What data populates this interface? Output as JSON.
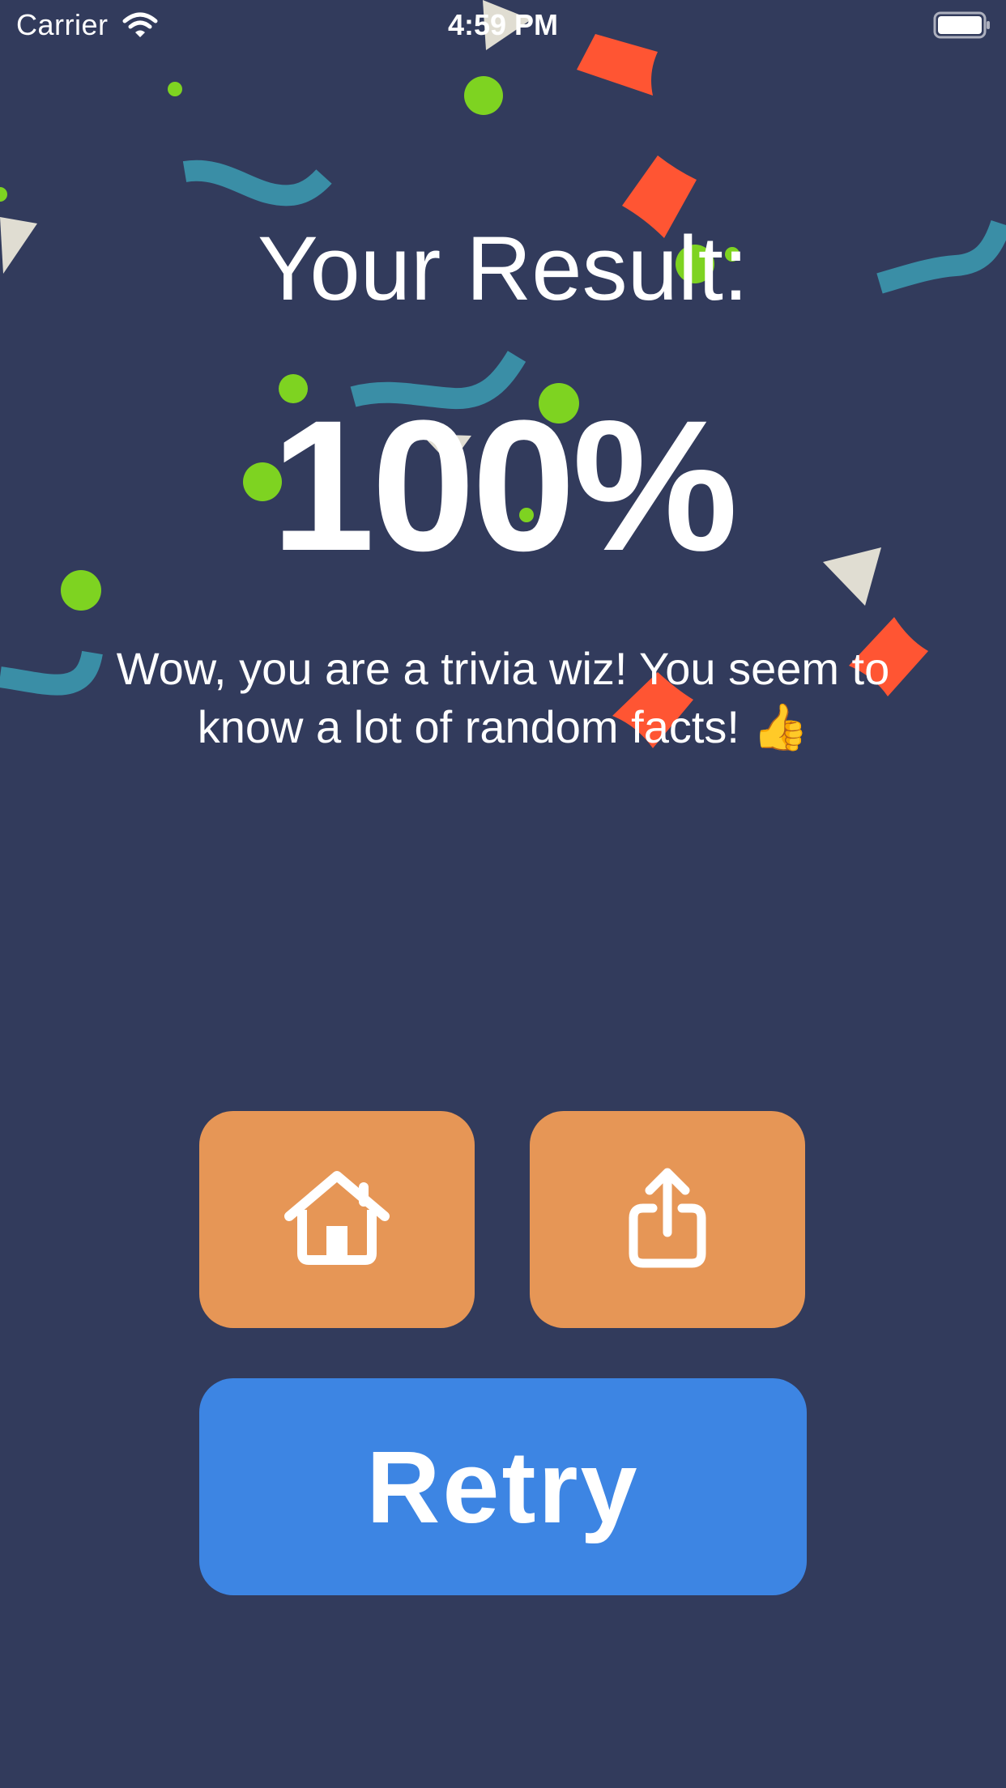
{
  "status_bar": {
    "carrier": "Carrier",
    "time": "4:59 PM",
    "wifi_icon": "wifi-icon",
    "battery_icon": "battery-icon"
  },
  "result": {
    "title": "Your Result:",
    "score": "100%",
    "message": "Wow, you are a trivia wiz! You seem to know a lot of random facts! 👍"
  },
  "actions": {
    "home_icon": "home-icon",
    "share_icon": "share-icon",
    "retry_label": "Retry"
  },
  "colors": {
    "background": "#323b5c",
    "secondary_button": "#e69656",
    "primary_button": "#3d85e3",
    "confetti_green": "#7ed321",
    "confetti_red": "#ff5533",
    "confetti_teal": "#3a8ea6",
    "confetti_cream": "#e0ddd2"
  }
}
